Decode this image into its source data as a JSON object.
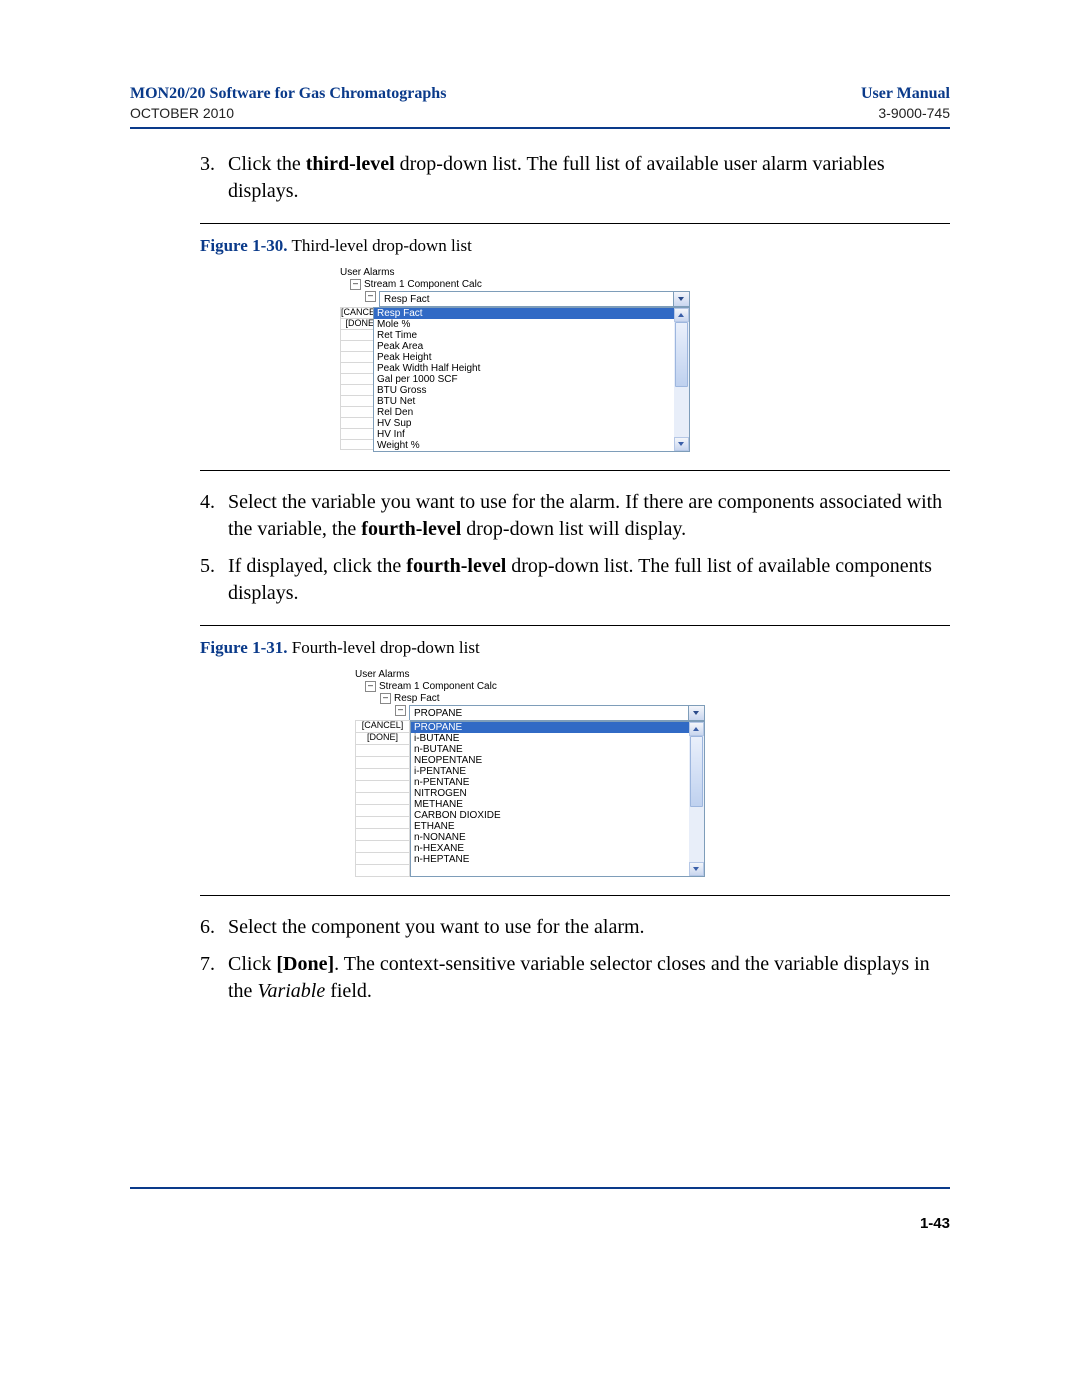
{
  "header": {
    "title_left": "MON20/20 Software for Gas Chromatographs",
    "title_right": "User Manual",
    "sub_left": "OCTOBER 2010",
    "sub_right": "3-9000-745"
  },
  "step3": {
    "num": "3.",
    "t1": "Click the ",
    "bold1": "third-level",
    "t2": " drop-down list.  The full list of available user alarm variables displays."
  },
  "fig30": {
    "label": "Figure 1-30.",
    "caption": "  Third-level drop-down list",
    "tree": {
      "root": "User Alarms",
      "l2": "Stream 1 Component Calc",
      "l3_selected": "Resp Fact"
    },
    "side": {
      "cancel": "[CANCEL]",
      "done": "[DONE]"
    },
    "items": [
      "Resp Fact",
      "Mole %",
      "Ret Time",
      "Peak Area",
      "Peak Height",
      "Peak Width Half Height",
      "Gal per 1000 SCF",
      "BTU Gross",
      "BTU Net",
      "Rel Den",
      "HV Sup",
      "HV Inf",
      "Weight %"
    ]
  },
  "step4": {
    "num": "4.",
    "t1": "Select the variable you want to use for the alarm.  If there are components associated with the variable, the ",
    "bold1": "fourth-level",
    "t2": " drop-down list will display."
  },
  "step5": {
    "num": "5.",
    "t1": "If displayed, click the ",
    "bold1": "fourth-level",
    "t2": " drop-down list.  The full list of available components displays."
  },
  "fig31": {
    "label": "Figure 1-31.",
    "caption": "  Fourth-level drop-down list",
    "tree": {
      "root": "User Alarms",
      "l2": "Stream 1 Component Calc",
      "l3": "Resp Fact",
      "l4_selected": "PROPANE"
    },
    "side": {
      "cancel": "[CANCEL]",
      "done": "[DONE]"
    },
    "items": [
      "PROPANE",
      "i-BUTANE",
      "n-BUTANE",
      "NEOPENTANE",
      "i-PENTANE",
      "n-PENTANE",
      "NITROGEN",
      "METHANE",
      "CARBON DIOXIDE",
      "ETHANE",
      "n-NONANE",
      "n-HEXANE",
      "n-HEPTANE"
    ]
  },
  "step6": {
    "num": "6.",
    "t1": "Select the component you want to use for the alarm."
  },
  "step7": {
    "num": "7.",
    "t1": "Click ",
    "bold1": "[Done]",
    "t2": ".  The context-sensitive variable selector closes and the variable displays in the ",
    "ital1": "Variable",
    "t3": " field."
  },
  "page_num": "1-43"
}
